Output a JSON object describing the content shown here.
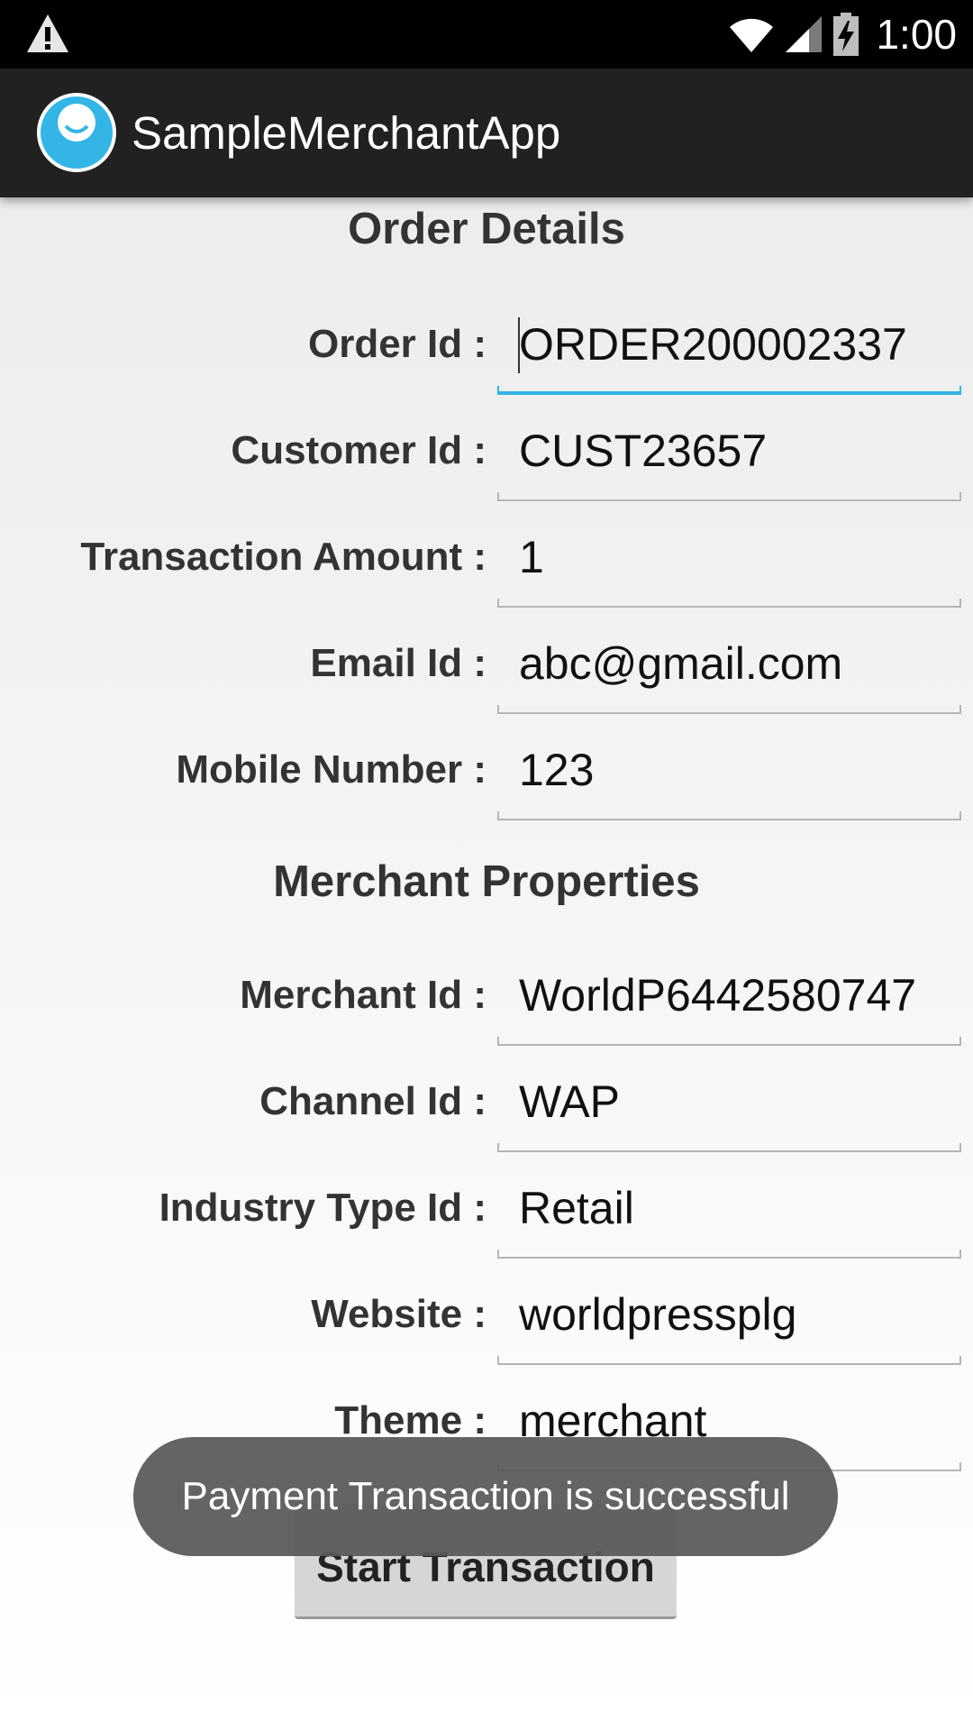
{
  "status_bar": {
    "time": "1:00",
    "icons": [
      "warning-icon",
      "wifi-icon",
      "signal-icon",
      "battery-charging-icon"
    ]
  },
  "action_bar": {
    "title": "SampleMerchantApp",
    "icon": "app-avatar-icon"
  },
  "order_details": {
    "title": "Order Details",
    "fields": [
      {
        "label": "Order Id :",
        "value": "ORDER200002337"
      },
      {
        "label": "Customer Id :",
        "value": "CUST23657"
      },
      {
        "label": "Transaction Amount :",
        "value": "1"
      },
      {
        "label": "Email Id :",
        "value": "abc@gmail.com"
      },
      {
        "label": "Mobile Number :",
        "value": "123"
      }
    ]
  },
  "merchant_properties": {
    "title": "Merchant Properties",
    "fields": [
      {
        "label": "Merchant Id :",
        "value": "WorldP6442580747"
      },
      {
        "label": "Channel Id :",
        "value": "WAP"
      },
      {
        "label": "Industry Type Id :",
        "value": "Retail"
      },
      {
        "label": "Website :",
        "value": "worldpressplg"
      },
      {
        "label": "Theme :",
        "value": "merchant"
      }
    ]
  },
  "start_button_label": "Start Transaction",
  "toast_message": "Payment Transaction is successful",
  "colors": {
    "status_bar": "#000000",
    "action_bar": "#212121",
    "focus_accent": "#33b5e5",
    "app_icon": "#33b5e5",
    "toast_bg": "#585858"
  }
}
